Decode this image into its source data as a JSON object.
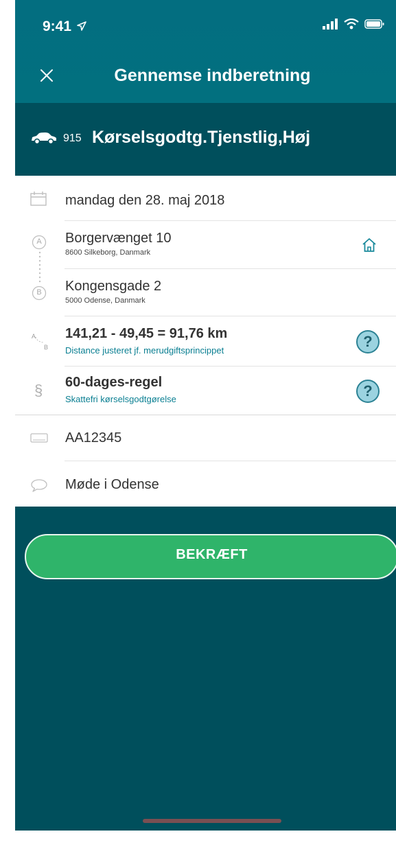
{
  "status_bar": {
    "time": "9:41"
  },
  "nav": {
    "title": "Gennemse indberetning"
  },
  "category": {
    "code": "915",
    "name": "Kørselsgodtg.Tjenstlig,Høj"
  },
  "date_row": {
    "text": "mandag den 28. maj 2018"
  },
  "route": {
    "from": {
      "marker": "A",
      "street": "Borgervænget 10",
      "city": "8600 Silkeborg, Danmark"
    },
    "to": {
      "marker": "B",
      "street": "Kongensgade 2",
      "city": "5000 Odense, Danmark"
    }
  },
  "distance": {
    "icon_from": "A",
    "icon_to": "B",
    "value": "141,21 - 49,45 = 91,76 km",
    "note": "Distance justeret jf. merudgiftsprincippet"
  },
  "rule": {
    "symbol": "§",
    "title": "60-dages-regel",
    "note": "Skattefri kørselsgodtgørelse"
  },
  "plate": {
    "text": "AA12345"
  },
  "comment": {
    "text": "Møde i Odense"
  },
  "help": {
    "label": "?"
  },
  "confirm": {
    "label": "BEKRÆFT"
  },
  "colors": {
    "header": "#036e80",
    "background": "#004f5c",
    "accent": "#0a7f92",
    "confirm": "#2fb46a",
    "help_fill": "#9bd3e0"
  },
  "icons": [
    "location-arrow-icon",
    "signal-icon",
    "wifi-icon",
    "battery-icon",
    "close-icon",
    "car-icon",
    "calendar-icon",
    "home-icon",
    "help-icon",
    "license-plate-icon",
    "comment-icon"
  ]
}
